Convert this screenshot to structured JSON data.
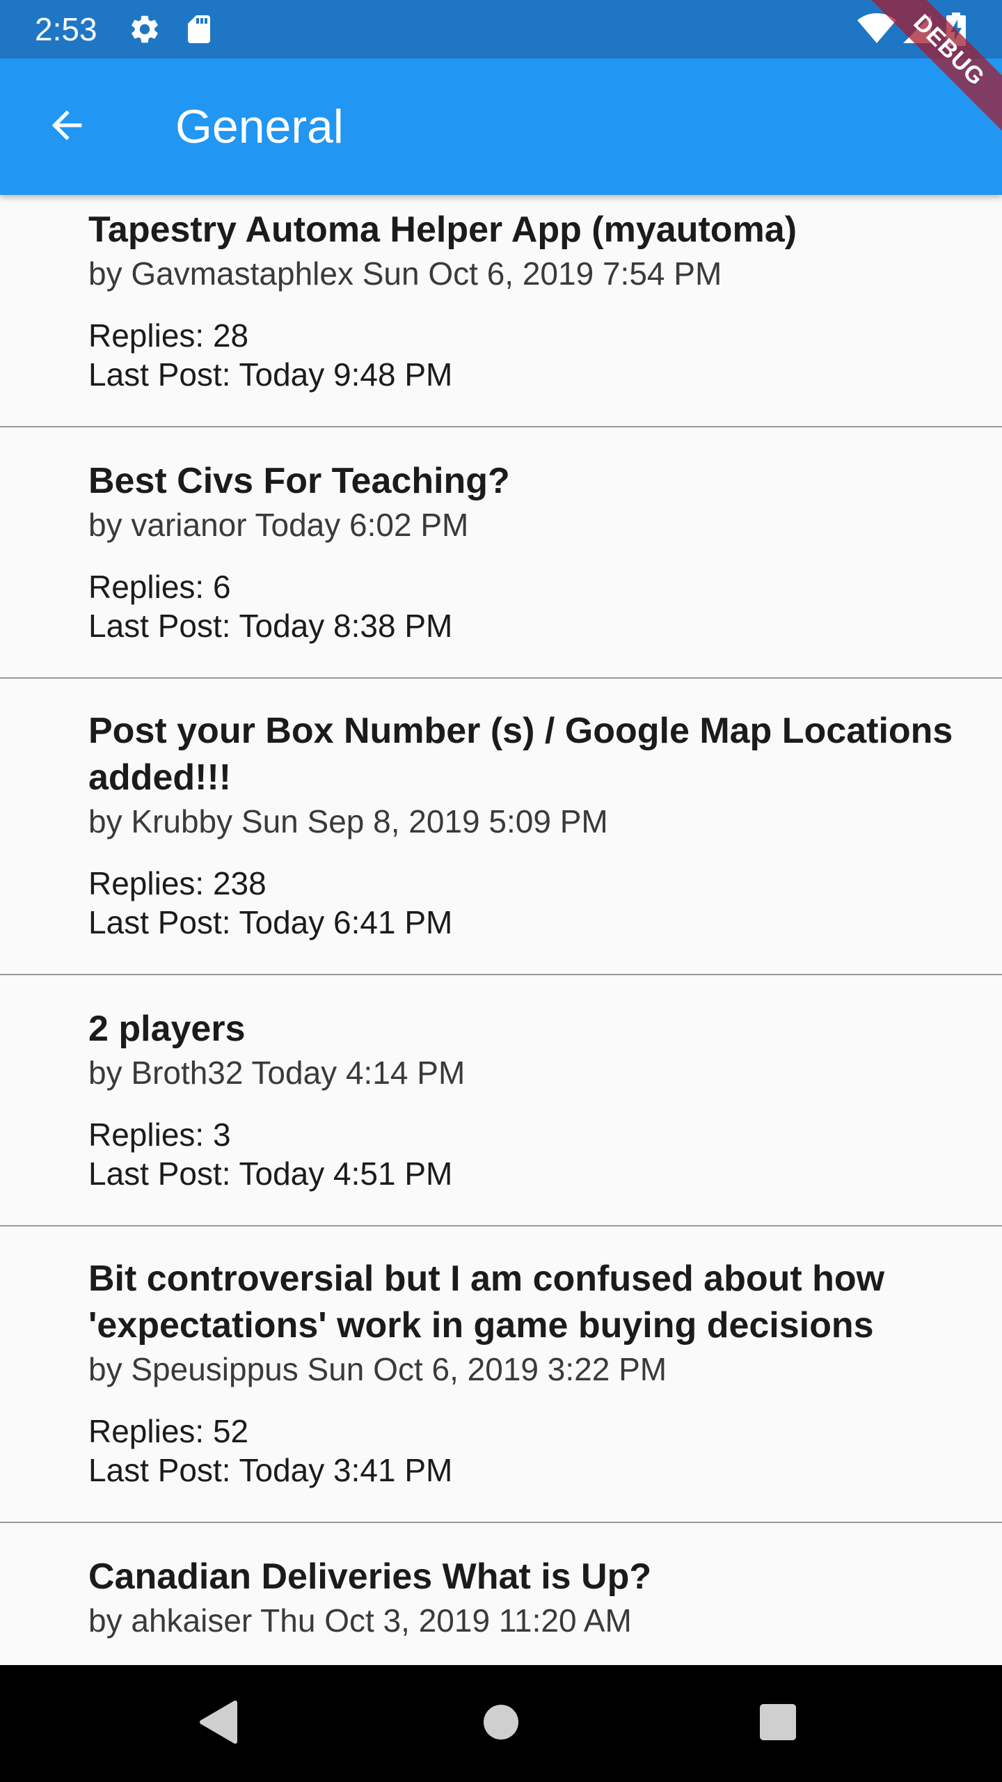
{
  "status_bar": {
    "time": "2:53",
    "icons": [
      "settings-icon",
      "sd-card-icon",
      "wifi-icon",
      "signal-icon",
      "battery-charging-icon"
    ]
  },
  "app_bar": {
    "title": "General",
    "back_icon": "arrow-back-icon"
  },
  "debug_banner": "DEBUG",
  "topics": [
    {
      "title": "Tapestry Automa Helper App (myautoma)",
      "meta": "by Gavmastaphlex Sun Oct 6, 2019 7:54 PM",
      "replies": "Replies: 28",
      "last_post": "Last Post: Today 9:48 PM"
    },
    {
      "title": "Best Civs For Teaching?",
      "meta": "by varianor Today 6:02 PM",
      "replies": "Replies: 6",
      "last_post": "Last Post: Today 8:38 PM"
    },
    {
      "title": "Post your Box Number (s) / Google Map Locations added!!!",
      "meta": "by Krubby Sun Sep 8, 2019 5:09 PM",
      "replies": "Replies: 238",
      "last_post": "Last Post: Today 6:41 PM"
    },
    {
      "title": "2 players",
      "meta": "by Broth32 Today 4:14 PM",
      "replies": "Replies: 3",
      "last_post": "Last Post: Today 4:51 PM"
    },
    {
      "title": "Bit controversial but I am confused about how 'expectations' work in game buying decisions",
      "meta": "by Speusippus Sun Oct 6, 2019 3:22 PM",
      "replies": "Replies: 52",
      "last_post": "Last Post: Today 3:41 PM"
    },
    {
      "title": "Canadian Deliveries What is Up?",
      "meta": "by ahkaiser Thu Oct 3, 2019 11:20 AM"
    }
  ],
  "nav_bar": {
    "buttons": [
      "back-triangle-icon",
      "home-circle-icon",
      "recents-square-icon"
    ]
  },
  "colors": {
    "status_bar": "#1f76c4",
    "app_bar": "#2196f3",
    "background": "#fafafa",
    "divider": "#9a9a9a",
    "nav_bar": "#000000",
    "debug": "#a01e32"
  }
}
